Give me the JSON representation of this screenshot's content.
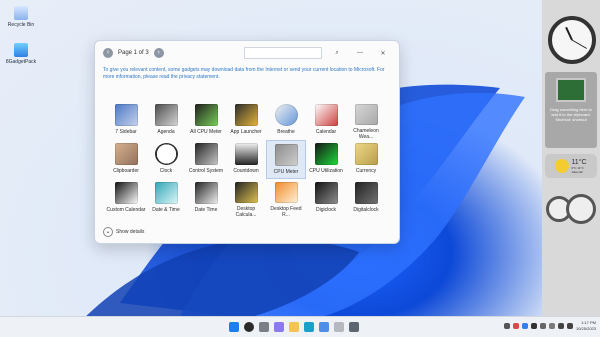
{
  "desktop": {
    "icons": [
      {
        "label": "Recycle Bin"
      },
      {
        "label": "8GadgetPack"
      }
    ]
  },
  "gallery": {
    "page_label": "Page 1 of 3",
    "search_placeholder": "",
    "notice": "To give you relevant content, some gadgets may download data from the Internet or send your current location to Microsoft. For more information, please read the privacy statement.",
    "items": [
      {
        "label": "7 Sidebar",
        "colors": [
          "#4a77c7",
          "#c7d3ea"
        ]
      },
      {
        "label": "Agenda",
        "colors": [
          "#4b4b4b",
          "#d8d8d8"
        ]
      },
      {
        "label": "All CPU Meter",
        "colors": [
          "#1e1e1e",
          "#7cd25a"
        ]
      },
      {
        "label": "App Launcher",
        "colors": [
          "#2b2b2b",
          "#e7b73b"
        ]
      },
      {
        "label": "Breathe",
        "colors": [
          "#f2f2f2",
          "#5f94d8"
        ]
      },
      {
        "label": "Calendar",
        "colors": [
          "#ffffff",
          "#cc3d3d"
        ]
      },
      {
        "label": "Chameleon Wea...",
        "colors": [
          "#d7d7d7",
          "#a8a8a8"
        ]
      },
      {
        "label": "Clipboarder",
        "colors": [
          "#d8b18f",
          "#91705b"
        ]
      },
      {
        "label": "Clock",
        "colors": [
          "#ffffff",
          "#333333"
        ]
      },
      {
        "label": "Control System",
        "colors": [
          "#222222",
          "#c9c9c9"
        ]
      },
      {
        "label": "Countdown",
        "colors": [
          "#f3f3f3",
          "#222222"
        ]
      },
      {
        "label": "CPU Meter",
        "colors": [
          "#8b8b8b",
          "#d0d0d0"
        ]
      },
      {
        "label": "CPU Utilization",
        "colors": [
          "#151515",
          "#1fdb3b"
        ]
      },
      {
        "label": "Currency",
        "colors": [
          "#eed889",
          "#b89d48"
        ]
      },
      {
        "label": "Custom Calendar",
        "colors": [
          "#111111",
          "#ffffff"
        ]
      },
      {
        "label": "Date & Time",
        "colors": [
          "#30a6b5",
          "#dff7fb"
        ]
      },
      {
        "label": "Date Time",
        "colors": [
          "#222222",
          "#f2f2f2"
        ]
      },
      {
        "label": "Desktop Calcula...",
        "colors": [
          "#222222",
          "#e0c451"
        ]
      },
      {
        "label": "Desktop Feed R...",
        "colors": [
          "#f08b2a",
          "#fff1d8"
        ]
      },
      {
        "label": "Digiclock",
        "colors": [
          "#111111",
          "#8f8f8f"
        ]
      },
      {
        "label": "Digitalclock",
        "colors": [
          "#222222",
          "#737373"
        ]
      }
    ],
    "details_label": "Show details"
  },
  "sidebar": {
    "widget_text": "Drag something here to add it to the clipboard. Shortcut: shortcut",
    "weather": {
      "temp": "11°C",
      "line1": "0°C 11°C",
      "line2": "Jalan Eli"
    }
  },
  "taskbar": {
    "time": "1:17 PM",
    "date": "10/25/2023"
  }
}
